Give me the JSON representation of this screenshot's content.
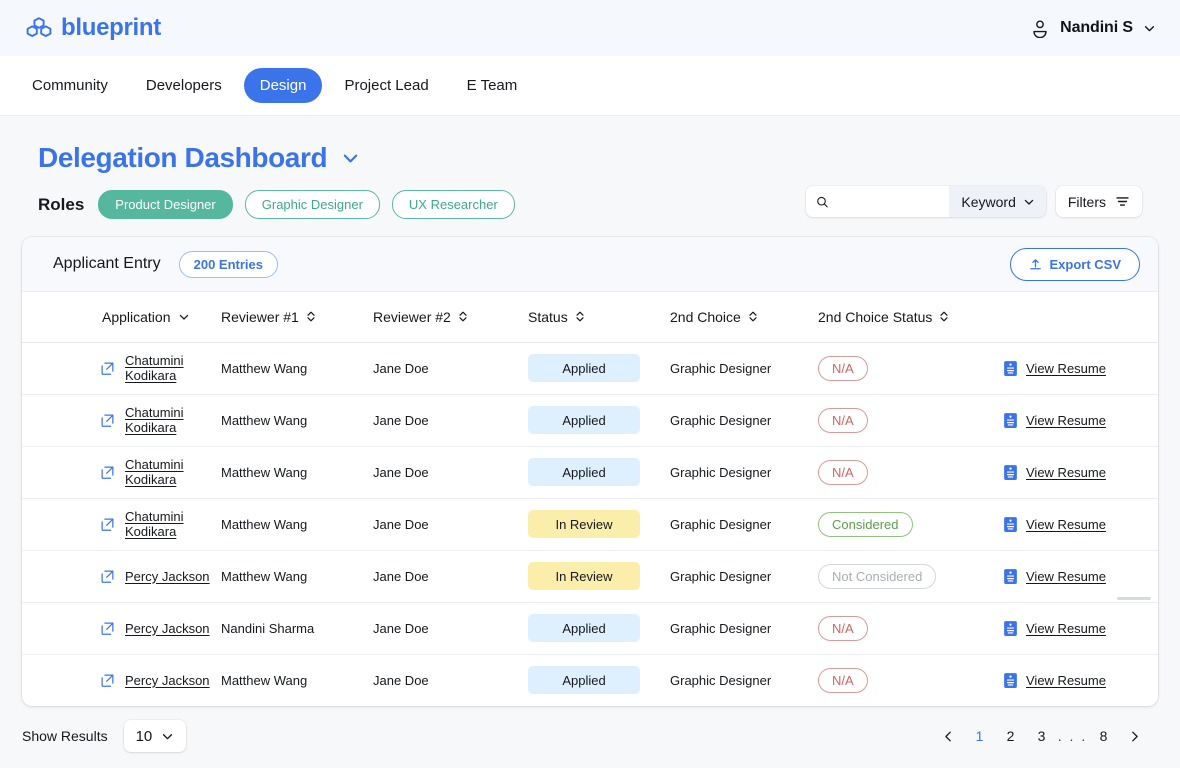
{
  "header": {
    "brand": "blueprint",
    "brand_color": "#3b74ea",
    "logo_icon": "blueprint-logo-icon",
    "user_name": "Nandini S",
    "user_icon": "person-icon",
    "user_caret_icon": "chevron-down-icon"
  },
  "nav": {
    "items": [
      {
        "label": "Community",
        "active": false
      },
      {
        "label": "Developers",
        "active": false
      },
      {
        "label": "Design",
        "active": true
      },
      {
        "label": "Project Lead",
        "active": false
      },
      {
        "label": "E Team",
        "active": false
      }
    ]
  },
  "page": {
    "title": "Delegation Dashboard",
    "title_caret_icon": "chevron-down-icon",
    "roles_label": "Roles",
    "roles": [
      {
        "label": "Product Designer",
        "selected": true
      },
      {
        "label": "Graphic Designer",
        "selected": false
      },
      {
        "label": "UX Researcher",
        "selected": false
      }
    ],
    "role_selected_color": "#55b79d",
    "role_outline_color": "#3da88c"
  },
  "search": {
    "icon": "search-icon",
    "value": "",
    "placeholder": "",
    "scope_label": "Keyword",
    "scope_caret_icon": "chevron-down-icon",
    "filters_label": "Filters",
    "filters_icon": "filter-icon"
  },
  "card": {
    "title": "Applicant Entry",
    "entries_badge": "200 Entries",
    "export_label": "Export CSV",
    "export_icon": "upload-icon"
  },
  "table": {
    "columns": [
      {
        "label": "Application",
        "sort_icon": "chevron-down-icon"
      },
      {
        "label": "Reviewer #1",
        "sort_icon": "sort-updown-icon"
      },
      {
        "label": "Reviewer #2",
        "sort_icon": "sort-updown-icon"
      },
      {
        "label": "Status",
        "sort_icon": "sort-updown-icon"
      },
      {
        "label": "2nd Choice",
        "sort_icon": "sort-updown-icon"
      },
      {
        "label": "2nd Choice Status",
        "sort_icon": "sort-updown-icon"
      },
      {
        "label": ""
      }
    ],
    "row_link_icon": "external-link-icon",
    "resume_icon": "document-icon",
    "resume_label": "View Resume",
    "rows": [
      {
        "application": "Chatumini Kodikara",
        "reviewer1": "Matthew Wang",
        "reviewer2": "Jane Doe",
        "status": "Applied",
        "status_kind": "applied",
        "second_choice": "Graphic Designer",
        "second_status": "N/A",
        "second_status_kind": "na",
        "resume": "View Resume"
      },
      {
        "application": "Chatumini Kodikara",
        "reviewer1": "Matthew Wang",
        "reviewer2": "Jane Doe",
        "status": "Applied",
        "status_kind": "applied",
        "second_choice": "Graphic Designer",
        "second_status": "N/A",
        "second_status_kind": "na",
        "resume": "View Resume"
      },
      {
        "application": "Chatumini Kodikara",
        "reviewer1": "Matthew Wang",
        "reviewer2": "Jane Doe",
        "status": "Applied",
        "status_kind": "applied",
        "second_choice": "Graphic Designer",
        "second_status": "N/A",
        "second_status_kind": "na",
        "resume": "View Resume"
      },
      {
        "application": "Chatumini Kodikara",
        "reviewer1": "Matthew Wang",
        "reviewer2": "Jane Doe",
        "status": "In Review",
        "status_kind": "inreview",
        "second_choice": "Graphic Designer",
        "second_status": "Considered",
        "second_status_kind": "cons",
        "resume": "View Resume"
      },
      {
        "application": "Percy Jackson",
        "reviewer1": "Matthew Wang",
        "reviewer2": "Jane Doe",
        "status": "In Review",
        "status_kind": "inreview",
        "second_choice": "Graphic Designer",
        "second_status": "Not Considered",
        "second_status_kind": "notcons",
        "resume": "View Resume"
      },
      {
        "application": "Percy Jackson",
        "reviewer1": "Nandini Sharma",
        "reviewer2": "Jane Doe",
        "status": "Applied",
        "status_kind": "applied",
        "second_choice": "Graphic Designer",
        "second_status": "N/A",
        "second_status_kind": "na",
        "resume": "View Resume"
      },
      {
        "application": "Percy Jackson",
        "reviewer1": "Matthew Wang",
        "reviewer2": "Jane Doe",
        "status": "Applied",
        "status_kind": "applied",
        "second_choice": "Graphic Designer",
        "second_status": "N/A",
        "second_status_kind": "na",
        "resume": "View Resume"
      }
    ]
  },
  "footer": {
    "show_results_label": "Show Results",
    "page_size": "10",
    "page_size_caret_icon": "chevron-down-icon",
    "prev_icon": "chevron-left-icon",
    "next_icon": "chevron-right-icon",
    "pages": [
      "1",
      "2",
      "3",
      ". . .",
      "8"
    ],
    "active_page": "1",
    "active_page_color": "#3b74ea"
  }
}
